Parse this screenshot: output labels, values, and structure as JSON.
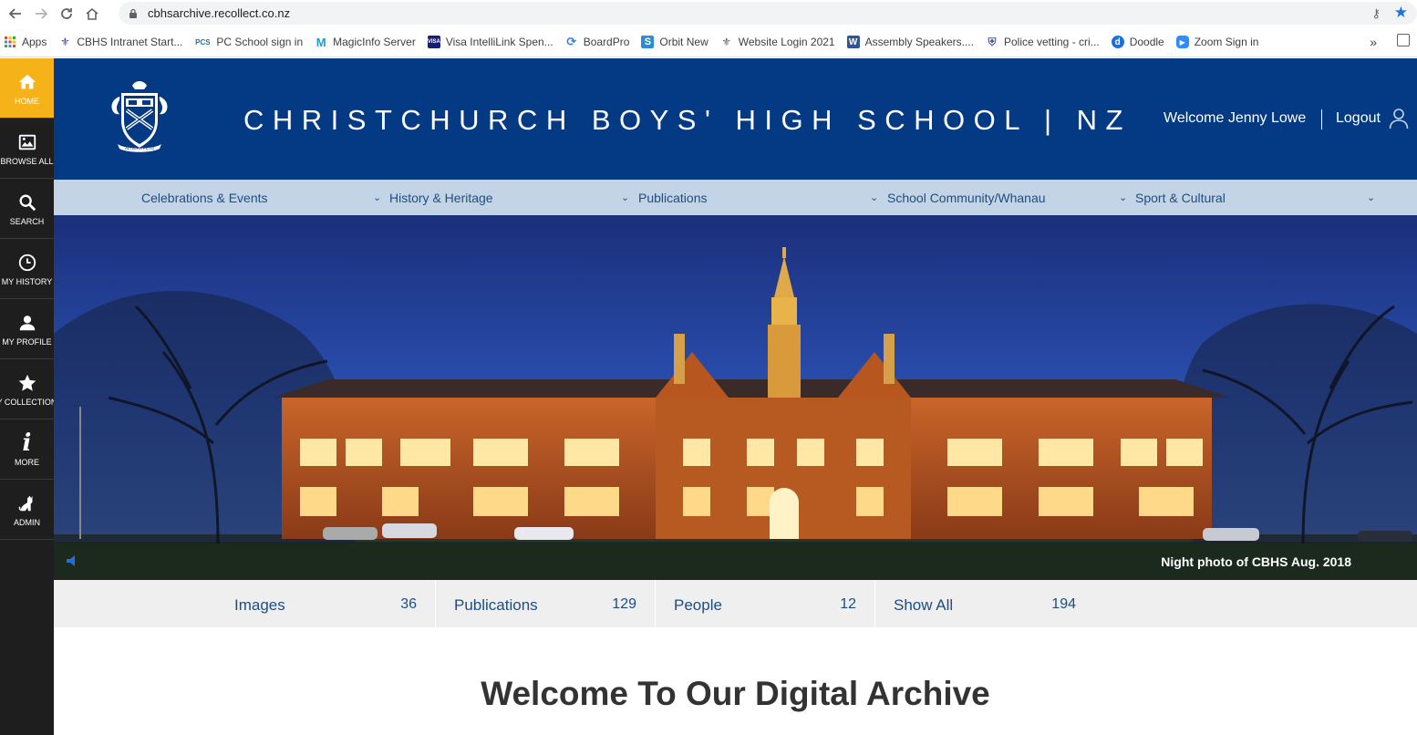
{
  "browser": {
    "url": "cbhsarchive.recollect.co.nz",
    "bookmarks": [
      {
        "label": "Apps",
        "icon": "apps-grid-icon",
        "color": "#ea4335"
      },
      {
        "label": "CBHS Intranet Start...",
        "icon": "crest-icon",
        "color": "#4a4a8a"
      },
      {
        "label": "PC School sign in",
        "icon": "pcs-icon",
        "color": "#2a6f97"
      },
      {
        "label": "MagicInfo Server",
        "icon": "m-icon",
        "color": "#1a9bd7"
      },
      {
        "label": "Visa IntelliLink Spen...",
        "icon": "visa-icon",
        "color": "#1a1f71"
      },
      {
        "label": "BoardPro",
        "icon": "boardpro-icon",
        "color": "#3a7bd5"
      },
      {
        "label": "Orbit New",
        "icon": "s-icon",
        "color": "#2a8dd6"
      },
      {
        "label": "Website Login 2021",
        "icon": "crest-icon",
        "color": "#666666"
      },
      {
        "label": "Assembly Speakers....",
        "icon": "word-icon",
        "color": "#2b579a"
      },
      {
        "label": "Police vetting - cri...",
        "icon": "police-icon",
        "color": "#4a5a8a"
      },
      {
        "label": "Doodle",
        "icon": "doodle-icon",
        "color": "#1e6fd9"
      },
      {
        "label": "Zoom Sign in",
        "icon": "zoom-icon",
        "color": "#2d8cff"
      }
    ],
    "more": "»"
  },
  "sidebar": {
    "items": [
      {
        "label": "HOME",
        "icon": "home-icon",
        "active": true
      },
      {
        "label": "BROWSE ALL",
        "icon": "image-gallery-icon",
        "active": false
      },
      {
        "label": "SEARCH",
        "icon": "search-icon",
        "active": false
      },
      {
        "label": "MY HISTORY",
        "icon": "clock-icon",
        "active": false
      },
      {
        "label": "MY PROFILE",
        "icon": "person-icon",
        "active": false
      },
      {
        "label": "Y COLLECTION",
        "icon": "star-icon",
        "active": false
      },
      {
        "label": "MORE",
        "icon": "info-icon",
        "active": false
      },
      {
        "label": "ADMIN",
        "icon": "cat-icon",
        "active": false
      }
    ]
  },
  "header": {
    "title": "CHRISTCHURCH BOYS' HIGH SCHOOL | NZ",
    "welcome": "Welcome Jenny Lowe",
    "logout": "Logout",
    "crest_motto": "ALTIORA PETO"
  },
  "categories": [
    {
      "label": "Celebrations & Events"
    },
    {
      "label": "History & Heritage"
    },
    {
      "label": "Publications"
    },
    {
      "label": "School Community/Whanau"
    },
    {
      "label": "Sport & Cultural"
    }
  ],
  "hero": {
    "caption": "Night photo of CBHS Aug. 2018"
  },
  "stats": [
    {
      "label": "Images",
      "value": "36"
    },
    {
      "label": "Publications",
      "value": "129"
    },
    {
      "label": "People",
      "value": "12"
    },
    {
      "label": "Show All",
      "value": "194"
    }
  ],
  "main": {
    "heading": "Welcome To Our Digital Archive"
  },
  "colors": {
    "header_bg": "#033a83",
    "nav_bg": "#c3d4e6",
    "active_accent": "#f5b319",
    "link": "#1e4d82"
  }
}
